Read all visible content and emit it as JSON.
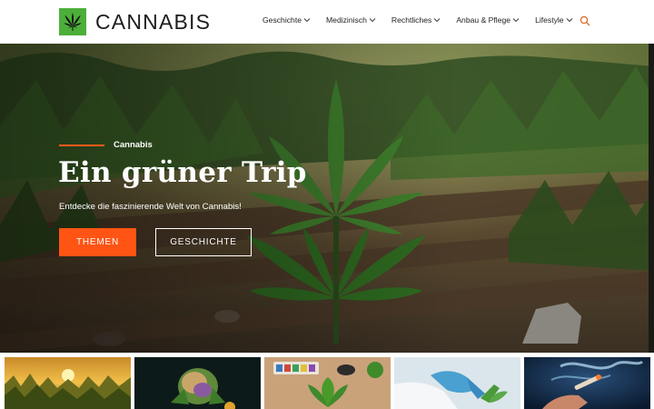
{
  "brand": {
    "name": "CANNABIS",
    "logo_icon": "cannabis-leaf-icon",
    "logo_color": "#4caf3a"
  },
  "nav": {
    "items": [
      {
        "label": "Geschichte"
      },
      {
        "label": "Medizinisch"
      },
      {
        "label": "Rechtliches"
      },
      {
        "label": "Anbau & Pflege"
      },
      {
        "label": "Lifestyle"
      }
    ],
    "search_icon": "search-icon"
  },
  "hero": {
    "eyebrow": "Cannabis",
    "title": "Ein grüner Trip",
    "subtitle": "Entdecke die faszinierende Welt von Cannabis!",
    "primary_button": "THEMEN",
    "secondary_button": "GESCHICHTE"
  },
  "colors": {
    "accent": "#ff5414",
    "brand_green": "#4caf3a"
  },
  "thumbnails": [
    {
      "name": "sunset-field"
    },
    {
      "name": "cannabis-bud"
    },
    {
      "name": "paint-palette-leaf"
    },
    {
      "name": "lab-gloves"
    },
    {
      "name": "smoking-hand"
    }
  ]
}
